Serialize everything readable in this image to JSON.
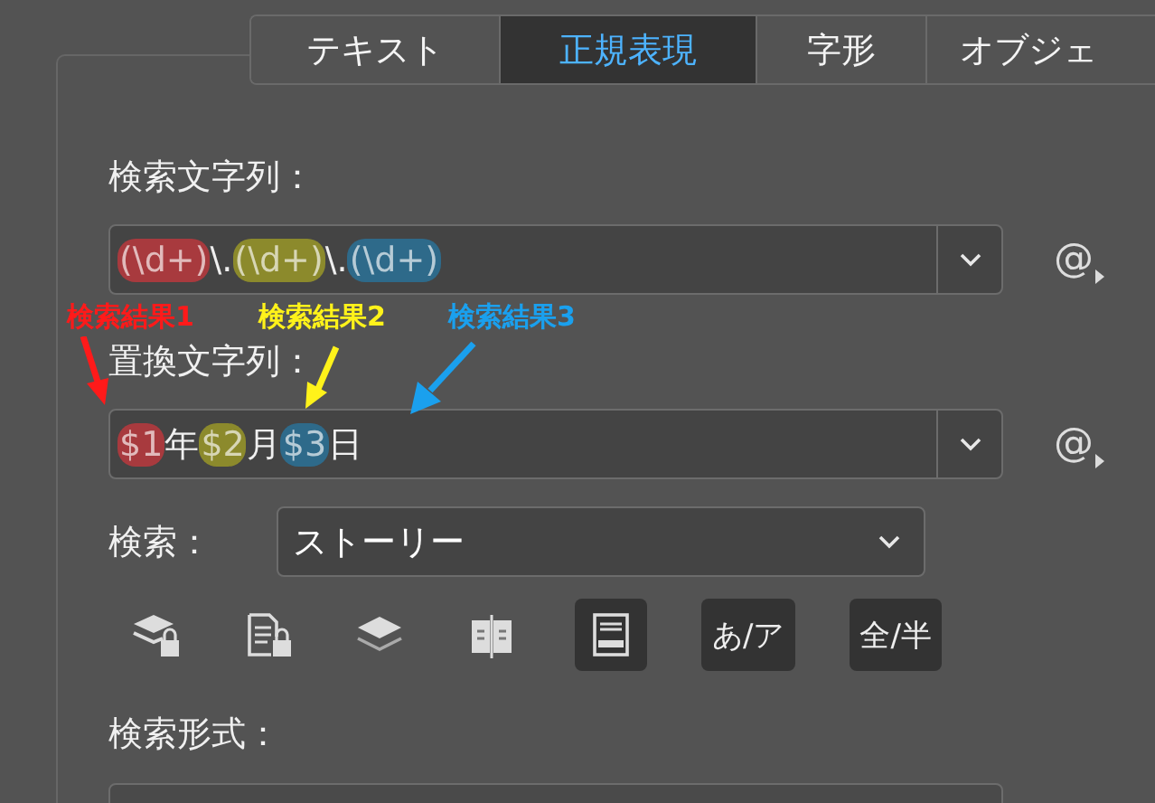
{
  "tabs": [
    {
      "label": "テキスト",
      "selected": false
    },
    {
      "label": "正規表現",
      "selected": true
    },
    {
      "label": "字形",
      "selected": false
    },
    {
      "label": "オブジェ",
      "selected": false
    }
  ],
  "find": {
    "label": "検索文字列：",
    "insert": "@",
    "segments": [
      {
        "text": "(\\d+)",
        "color": "#a83a3e"
      },
      {
        "text": "\\."
      },
      {
        "text": "(\\d+)",
        "color": "#8c8a2c"
      },
      {
        "text": "\\."
      },
      {
        "text": "(\\d+)",
        "color": "#2e6a8a"
      }
    ]
  },
  "annotations": [
    {
      "label": "検索結果1",
      "color": "#ff1a1a"
    },
    {
      "label": "検索結果2",
      "color": "#fff21a"
    },
    {
      "label": "検索結果3",
      "color": "#1aa0ee"
    }
  ],
  "replace": {
    "label": "置換文字列：",
    "insert": "@",
    "segments": [
      {
        "text": "$1",
        "color": "#a83a3e"
      },
      {
        "text": "年"
      },
      {
        "text": "$2",
        "color": "#8c8a2c"
      },
      {
        "text": "月"
      },
      {
        "text": "$3",
        "color": "#2e6a8a"
      },
      {
        "text": "日"
      }
    ]
  },
  "search": {
    "label": "検索：",
    "value": "ストーリー"
  },
  "options": [
    {
      "kind": "layers-lock",
      "on": false
    },
    {
      "kind": "doc-lock",
      "on": false
    },
    {
      "kind": "layers",
      "on": false
    },
    {
      "kind": "book",
      "on": false
    },
    {
      "kind": "panel",
      "on": true
    },
    {
      "kind": "text",
      "label": "あ/ア",
      "on": true
    },
    {
      "kind": "text",
      "label": "全/半",
      "on": true
    }
  ],
  "format": {
    "label": "検索形式："
  }
}
